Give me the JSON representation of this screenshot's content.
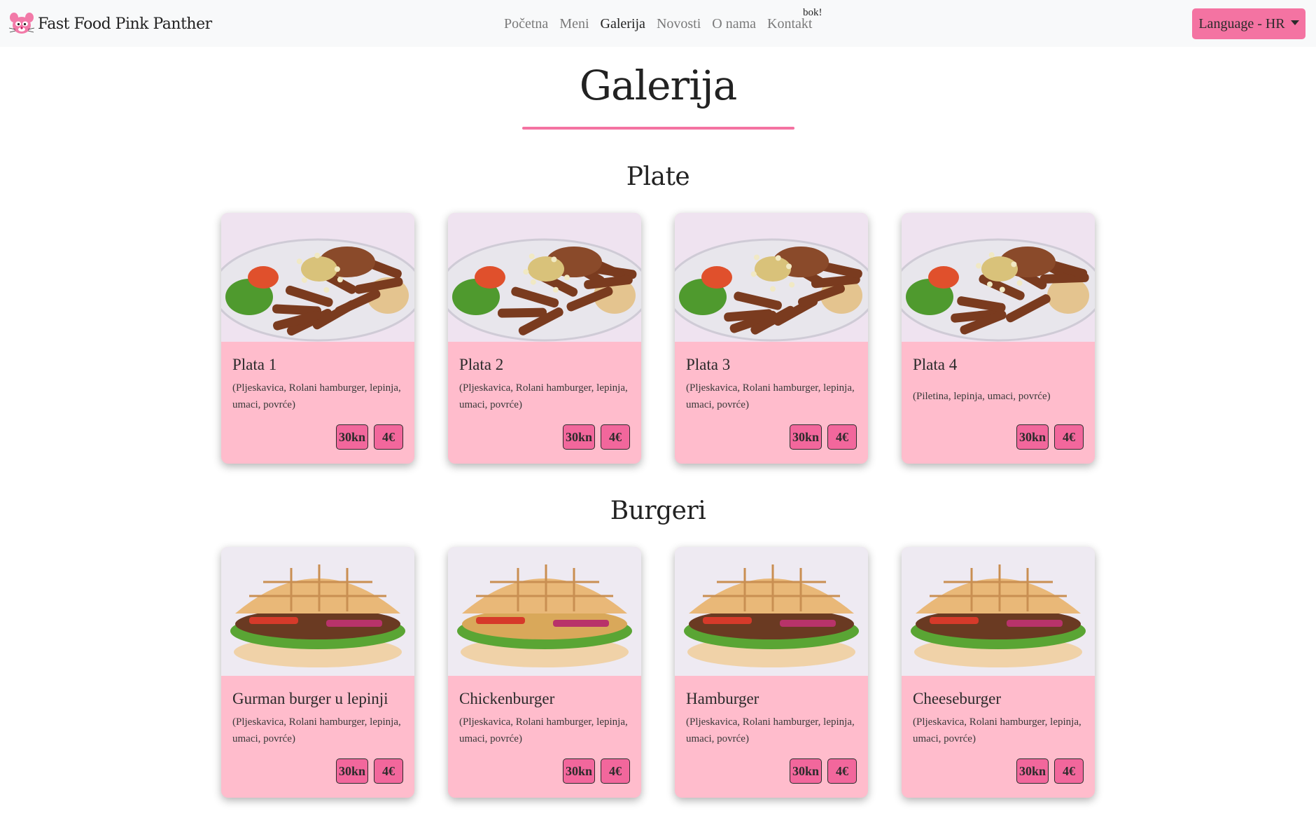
{
  "nav": {
    "brand": "Fast Food Pink Panther",
    "links": [
      "Početna",
      "Meni",
      "Galerija",
      "Novosti",
      "O nama",
      "Kontakt"
    ],
    "active_index": 2,
    "bok": "bok!",
    "language_button": "Language - HR"
  },
  "page": {
    "title": "Galerija"
  },
  "colors": {
    "accent": "#f473a2",
    "card_bg": "#ffbccc",
    "price_bg": "#f2679c"
  },
  "sections": [
    {
      "title": "Plate",
      "cards": [
        {
          "title": "Plata 1",
          "desc": "(Pljeskavica, Rolani hamburger, lepinja, umaci, povrće)",
          "price_kn": "30kn",
          "price_eur": "4€",
          "image": "platter-photo"
        },
        {
          "title": "Plata 2",
          "desc": "(Pljeskavica, Rolani hamburger, lepinja, umaci, povrće)",
          "price_kn": "30kn",
          "price_eur": "4€",
          "image": "platter-photo"
        },
        {
          "title": "Plata 3",
          "desc": "(Pljeskavica, Rolani hamburger, lepinja, umaci, povrće)",
          "price_kn": "30kn",
          "price_eur": "4€",
          "image": "platter-photo"
        },
        {
          "title": "Plata 4",
          "desc": "(Piletina, lepinja, umaci, povrće)",
          "price_kn": "30kn",
          "price_eur": "4€",
          "image": "platter-photo"
        }
      ]
    },
    {
      "title": "Burgeri",
      "cards": [
        {
          "title": "Gurman burger u lepinji",
          "desc": "(Pljeskavica, Rolani hamburger, lepinja, umaci, povrće)",
          "price_kn": "30kn",
          "price_eur": "4€",
          "image": "burger-photo"
        },
        {
          "title": "Chickenburger",
          "desc": "(Pljeskavica, Rolani hamburger, lepinja, umaci, povrće)",
          "price_kn": "30kn",
          "price_eur": "4€",
          "image": "burger-photo"
        },
        {
          "title": "Hamburger",
          "desc": "(Pljeskavica, Rolani hamburger, lepinja, umaci, povrće)",
          "price_kn": "30kn",
          "price_eur": "4€",
          "image": "burger-photo"
        },
        {
          "title": "Cheeseburger",
          "desc": "(Pljeskavica, Rolani hamburger, lepinja, umaci, povrće)",
          "price_kn": "30kn",
          "price_eur": "4€",
          "image": "burger-photo"
        }
      ]
    }
  ]
}
